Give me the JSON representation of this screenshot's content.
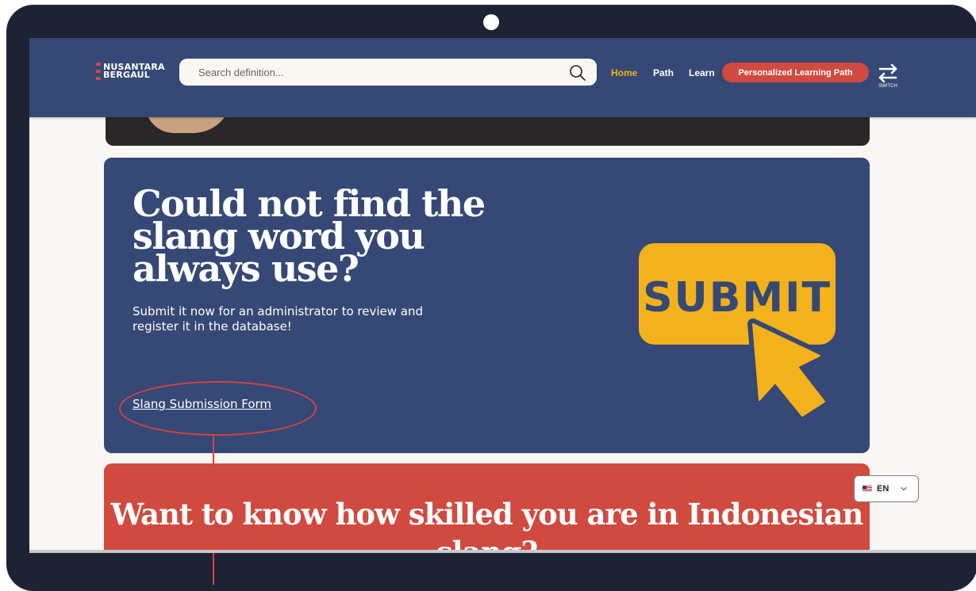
{
  "header": {
    "logo_line1": "NUSANTARA",
    "logo_line2": "BERGAUL",
    "search_placeholder": "Search definition...",
    "nav": [
      {
        "label": "Home",
        "active": true
      },
      {
        "label": "Path",
        "active": false
      },
      {
        "label": "Learn",
        "active": false
      }
    ],
    "cta_label": "Personalized Learning Path",
    "switch_label": "SWITCH"
  },
  "submit_section": {
    "heading": "Could not find the slang word you always use?",
    "description": "Submit it now for an administrator to review and register it in the database!",
    "link_label": "Slang Submission Form",
    "illustration_text": "SUBMIT"
  },
  "quiz_section": {
    "heading": "Want to know how skilled you are in Indonesian slang?"
  },
  "language": {
    "code": "EN"
  },
  "colors": {
    "header_bg": "#364875",
    "accent_red": "#d04a3f",
    "accent_yellow": "#f3b21b",
    "bezel": "#1e2235",
    "page_bg": "#faf6f3"
  },
  "icons": [
    "search-icon",
    "switch-icon",
    "flag-us-icon",
    "chevron-down-icon",
    "pointer-cursor-icon"
  ]
}
